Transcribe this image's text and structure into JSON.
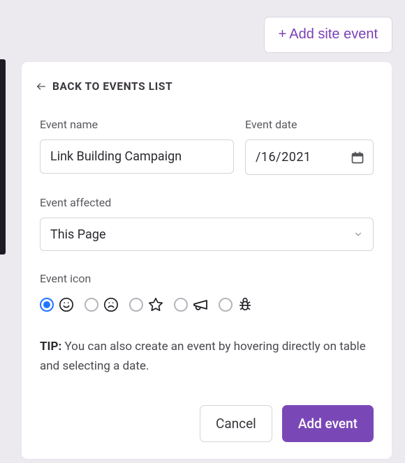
{
  "header": {
    "add_site_event_label": "Add site event"
  },
  "card": {
    "back_label": "BACK TO EVENTS LIST",
    "fields": {
      "name": {
        "label": "Event name",
        "value": "Link Building Campaign"
      },
      "date": {
        "label": "Event date",
        "value": "/16/2021"
      },
      "affected": {
        "label": "Event affected",
        "value": "This Page"
      },
      "icon": {
        "label": "Event icon",
        "options": [
          "smile",
          "frown",
          "star",
          "megaphone",
          "bug"
        ],
        "selected": "smile"
      }
    },
    "tip": {
      "label": "TIP:",
      "text": "You can also create an event by hovering directly on table and selecting a date."
    },
    "actions": {
      "cancel": "Cancel",
      "submit": "Add event"
    }
  }
}
